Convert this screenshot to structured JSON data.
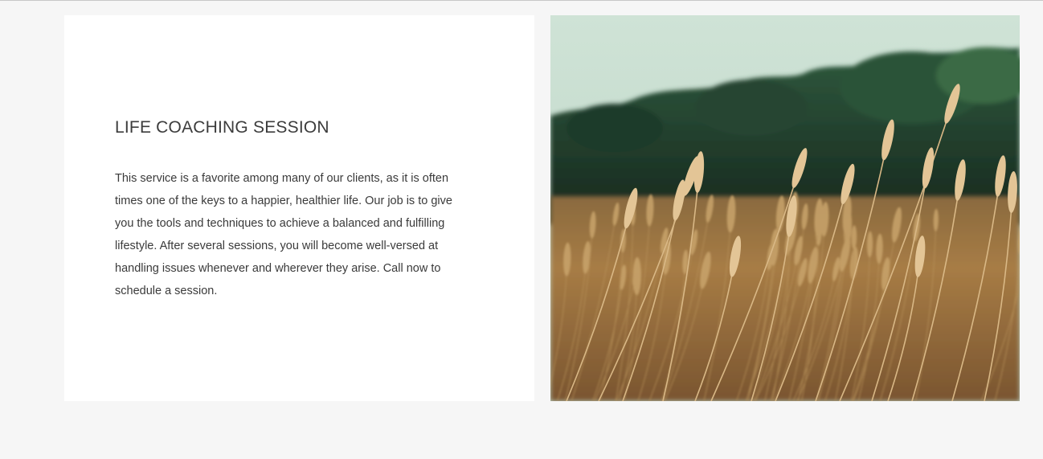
{
  "service": {
    "title": "LIFE COACHING SESSION",
    "description": "This service is a favorite among many of our clients, as it is often times one of the keys to a happier, healthier life. Our job is to give you the tools and techniques to achieve a balanced and fulfilling lifestyle. After several sessions, you will become well-versed at handling issues whenever and wherever they arise. Call now to schedule a session."
  },
  "colors": {
    "page_background": "#f6f6f6",
    "card_background": "#ffffff",
    "text": "#3a3a3a"
  }
}
